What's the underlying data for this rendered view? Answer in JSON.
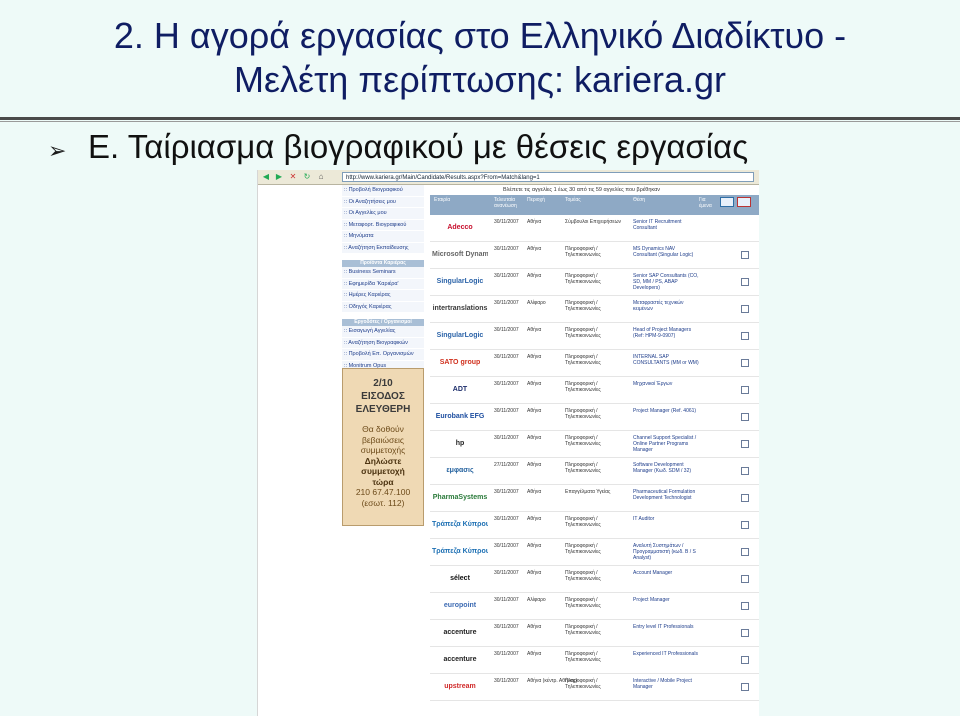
{
  "slide": {
    "title_line1": "2. Η αγορά εργασίας στο Ελληνικό Διαδίκτυο -",
    "title_line2": "Μελέτη περίπτωσης: kariera.gr",
    "bullet_text": "Ε. Ταίριασμα βιογραφικού με θέσεις εργασίας",
    "title_color": "#0f1d63"
  },
  "browser": {
    "url": "http://www.kariera.gr/Main/Candidate/Results.aspx?From=Match&lang=1"
  },
  "menu": {
    "groups": [
      {
        "header": "",
        "items": [
          ":: Προβολή Βιογραφικού",
          ":: Οι Αναζητήσεις μου",
          ":: Οι Αγγελίες μου",
          ":: Μεταφορτ. Βιογραφικού",
          ":: Μηνύματα",
          ":: Αναζήτηση Εκπαίδευσης"
        ]
      },
      {
        "header": "Προϊόντα Καριέρας",
        "items": [
          ":: Business Seminars",
          ":: Εφημερίδα 'Καριέρα'",
          ":: Ημέρες Καριέρας",
          ":: Οδηγός Καριέρας"
        ]
      },
      {
        "header": "Εργοδότες / Οργανισμοί",
        "items": [
          ":: Εισαγωγή Αγγελίας",
          ":: Αναζήτηση Βιογραφικών",
          ":: Προβολή Επ. Οργανισμών",
          ":: Monitrum Opus"
        ]
      }
    ]
  },
  "promo": {
    "line1": "2/10",
    "line2": "ΕΙΣΟΔΟΣ",
    "line3": "ΕΛΕΥΘΕΡΗ",
    "line4": "Θα δοθούν",
    "line5": "βεβαιώσεις",
    "line6": "συμμετοχής",
    "line7": "Δηλώστε",
    "line8": "συμμετοχή",
    "line9": "τώρα",
    "line10": "210 67.47.100",
    "line11": "(εσωτ. 112)"
  },
  "results": {
    "info": "Βλέπετε τις αγγελίες 1 έως 30 από τις 59 αγγελίες που βρέθηκαν",
    "headers": [
      "Εταιρία",
      "Τελευταία ανανέωση",
      "Περιοχή",
      "Τομέας",
      "Θέση",
      "Για έμενα"
    ],
    "rows": [
      {
        "logo": "Adecco",
        "logo_color": "#c8102e",
        "date": "30/11/2007",
        "loc": "Αθήνα",
        "sector": "Σύμβουλοι Επιχειρήσεων",
        "title": "Senior IT Recruitment Consultant"
      },
      {
        "logo": "Microsoft Dynamics",
        "logo_color": "#666666",
        "date": "30/11/2007",
        "loc": "Αθήνα",
        "sector": "Πληροφορική / Τηλεπικοινωνίες",
        "title": "MS Dynamics NAV Consultant (Singular Logic)"
      },
      {
        "logo": "SingularLogic",
        "logo_color": "#2b63a8",
        "date": "30/11/2007",
        "loc": "Αθήνα",
        "sector": "Πληροφορική / Τηλεπικοινωνίες",
        "title": "Senior SAP Consultants (CO, SD, MM / PS, ABAP Developers)"
      },
      {
        "logo": "intertranslations",
        "logo_color": "#3a3a3a",
        "date": "30/11/2007",
        "loc": "Αλίφαρο",
        "sector": "Πληροφορική / Τηλεπικοινωνίες",
        "title": "Μεταφραστές τεχνικών κειμένων"
      },
      {
        "logo": "SingularLogic",
        "logo_color": "#2b63a8",
        "date": "30/11/2007",
        "loc": "Αθήνα",
        "sector": "Πληροφορική / Τηλεπικοινωνίες",
        "title": "Head of Project Managers (Ref: HPM-9-0907)"
      },
      {
        "logo": "SATO group",
        "logo_color": "#d0301d",
        "date": "30/11/2007",
        "loc": "Αθήνα",
        "sector": "Πληροφορική / Τηλεπικοινωνίες",
        "title": "INTERNAL SAP CONSULTANTS (MM or WM)"
      },
      {
        "logo": "ADT",
        "logo_color": "#1c2d6b",
        "date": "30/11/2007",
        "loc": "Αθήνα",
        "sector": "Πληροφορική / Τηλεπικοινωνίες",
        "title": "Μηχανικοί Έργων"
      },
      {
        "logo": "Eurobank EFG",
        "logo_color": "#1d4ea0",
        "date": "30/11/2007",
        "loc": "Αθήνα",
        "sector": "Πληροφορική / Τηλεπικοινωνίες",
        "title": "Project Manager (Ref. 4061)"
      },
      {
        "logo": "hp",
        "logo_color": "#222222",
        "date": "30/11/2007",
        "loc": "Αθήνα",
        "sector": "Πληροφορική / Τηλεπικοινωνίες",
        "title": "Channel Support Specialist / Online Partner Programs Manager"
      },
      {
        "logo": "εμφασις",
        "logo_color": "#1f5e9c",
        "date": "27/11/2007",
        "loc": "Αθήνα",
        "sector": "Πληροφορική / Τηλεπικοινωνίες",
        "title": "Software Development Manager (Κωδ. SDM / 32)"
      },
      {
        "logo": "PharmaSystems",
        "logo_color": "#2a7a3a",
        "date": "30/11/2007",
        "loc": "Αθήνα",
        "sector": "Επαγγέλματα Υγείας",
        "title": "Pharmaceutical Formulation Development Technologist"
      },
      {
        "logo": "Τράπεζα Κύπρου",
        "logo_color": "#1c6fb3",
        "date": "30/11/2007",
        "loc": "Αθήνα",
        "sector": "Πληροφορική / Τηλεπικοινωνίες",
        "title": "IT Auditor"
      },
      {
        "logo": "Τράπεζα Κύπρου",
        "logo_color": "#1c6fb3",
        "date": "30/11/2007",
        "loc": "Αθήνα",
        "sector": "Πληροφορική / Τηλεπικοινωνίες",
        "title": "Αναλυτή Συστημάτων / Προγραμματιστή (κωδ. Β / S Analyst)"
      },
      {
        "logo": "sélect",
        "logo_color": "#111111",
        "date": "30/11/2007",
        "loc": "Αθήνα",
        "sector": "Πληροφορική / Τηλεπικοινωνίες",
        "title": "Account Manager"
      },
      {
        "logo": "europoint",
        "logo_color": "#3d6bb3",
        "date": "30/11/2007",
        "loc": "Αλίφαρο",
        "sector": "Πληροφορική / Τηλεπικοινωνίες",
        "title": "Project Manager"
      },
      {
        "logo": "accenture",
        "logo_color": "#222222",
        "date": "30/11/2007",
        "loc": "Αθήνα",
        "sector": "Πληροφορική / Τηλεπικοινωνίες",
        "title": "Entry level IT Professionals"
      },
      {
        "logo": "accenture",
        "logo_color": "#222222",
        "date": "30/11/2007",
        "loc": "Αθήνα",
        "sector": "Πληροφορική / Τηλεπικοινωνίες",
        "title": "Experienced IT Professionals"
      },
      {
        "logo": "upstream",
        "logo_color": "#d02a2a",
        "date": "30/11/2007",
        "loc": "Αθήνα (κέντρ. Αθήνας)",
        "sector": "Πληροφορική / Τηλεπικοινωνίες",
        "title": "Interactive / Mobile Project Manager"
      }
    ]
  }
}
